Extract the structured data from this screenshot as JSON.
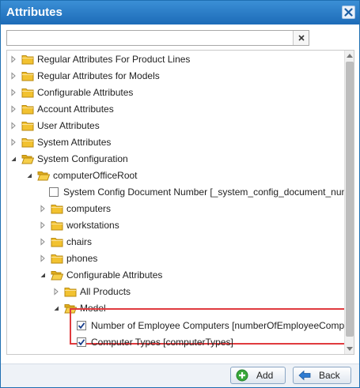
{
  "window": {
    "title": "Attributes"
  },
  "search": {
    "value": "",
    "placeholder": ""
  },
  "tree": {
    "regular_product_lines": "Regular Attributes For Product Lines",
    "regular_models": "Regular Attributes for Models",
    "configurable": "Configurable Attributes",
    "account": "Account Attributes",
    "user": "User Attributes",
    "system": "System Attributes",
    "system_configuration": "System Configuration",
    "computer_office_root": "computerOfficeRoot",
    "system_config_doc_number": "System Config Document Number [_system_config_document_number]",
    "computers": "computers",
    "workstations": "workstations",
    "chairs": "chairs",
    "phones": "phones",
    "configurable_attributes_child": "Configurable Attributes",
    "all_products": "All Products",
    "model": "Model",
    "num_employee_computers": "Number of Employee Computers [numberOfEmployeeComputers]",
    "computer_types": "Computer Types [computerTypes]"
  },
  "checkboxes": {
    "system_config_doc_number": false,
    "num_employee_computers": true,
    "computer_types": true
  },
  "buttons": {
    "add": "Add",
    "back": "Back"
  },
  "colors": {
    "titlebar": "#2577c4",
    "highlight": "#e03a3e",
    "folder": "#f2c230",
    "add_icon": "#3aa83a",
    "back_icon": "#2f7bd1"
  }
}
